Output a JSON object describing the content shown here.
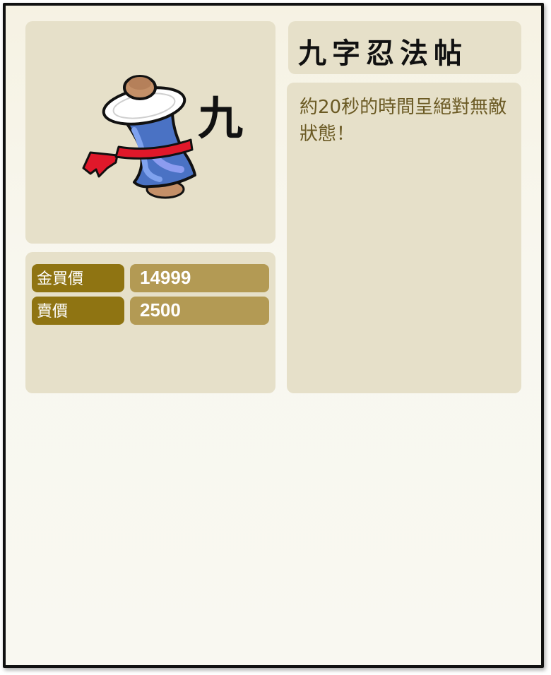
{
  "item": {
    "name": "九字忍法帖",
    "icon": "ninja-scroll-icon",
    "icon_glyph": "九",
    "description": "約20秒的時間呈絕對無敵狀態！"
  },
  "stats": [
    {
      "label": "金買價",
      "value": "14999"
    },
    {
      "label": "賣價",
      "value": "2500"
    }
  ],
  "colors": {
    "label_bg": "#8f7412",
    "value_bg": "#b39a54",
    "panel_bg": "#e6e0c9",
    "description_text": "#6b5a24",
    "scroll_body": "#4a72c4",
    "scroll_band": "#e0182a"
  }
}
